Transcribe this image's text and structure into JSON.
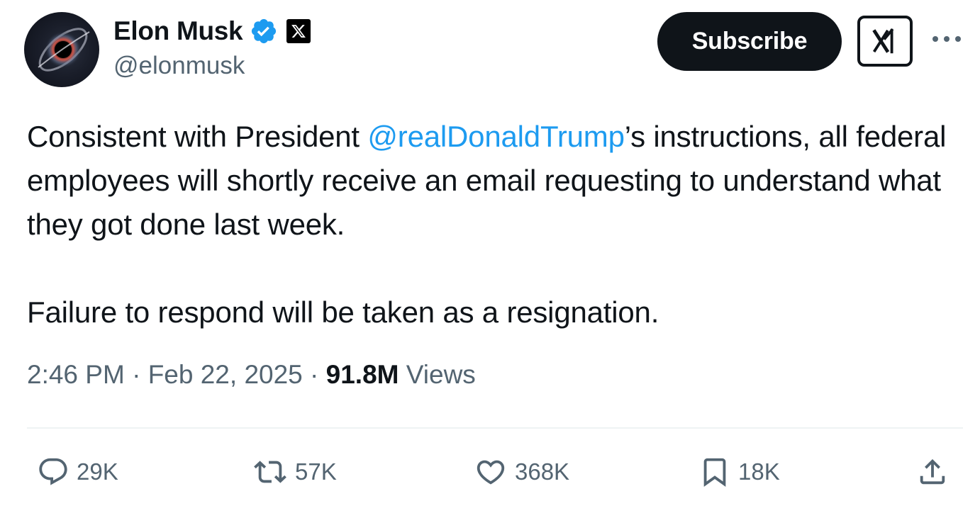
{
  "author": {
    "display_name": "Elon Musk",
    "handle": "@elonmusk",
    "verified": true
  },
  "header": {
    "subscribe_label": "Subscribe",
    "grok_icon": "grok-logo-icon",
    "more_icon": "more-dots-icon"
  },
  "tweet": {
    "text_before_mention": "Consistent with President ",
    "mention": "@realDonaldTrump",
    "text_after_mention": "’s instructions, all federal employees will shortly receive an email requesting to understand what they got done last week.",
    "paragraph_2": "Failure to respond will be taken as a resignation."
  },
  "meta": {
    "time": "2:46 PM",
    "separator": " · ",
    "date": "Feb 22, 2025",
    "views_count": "91.8M",
    "views_label": " Views"
  },
  "actions": {
    "replies": "29K",
    "reposts": "57K",
    "likes": "368K",
    "bookmarks": "18K"
  },
  "colors": {
    "text": "#0f1419",
    "secondary": "#536471",
    "link": "#1d9bf0",
    "verified": "#1d9bf0",
    "divider": "#eff3f4"
  }
}
